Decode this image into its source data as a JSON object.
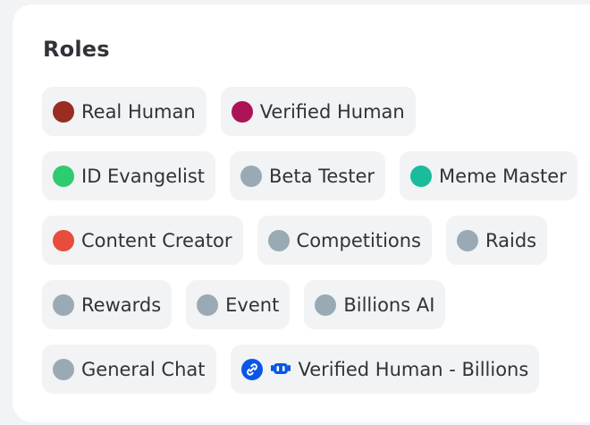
{
  "section": {
    "title": "Roles"
  },
  "colors": {
    "dark_red": "#992d22",
    "crimson": "#ad1457",
    "green": "#2ecc71",
    "gray": "#99aab5",
    "teal": "#1abc9c",
    "red": "#e74c3c",
    "blue": "#0a57e6"
  },
  "roles": [
    {
      "label": "Real Human",
      "color": "#992d22"
    },
    {
      "label": "Verified Human",
      "color": "#ad1457"
    },
    {
      "label": "ID Evangelist",
      "color": "#2ecc71"
    },
    {
      "label": "Beta Tester",
      "color": "#99aab5"
    },
    {
      "label": "Meme Master",
      "color": "#1abc9c"
    },
    {
      "label": "Content Creator",
      "color": "#e74c3c"
    },
    {
      "label": "Competitions",
      "color": "#99aab5"
    },
    {
      "label": "Raids",
      "color": "#99aab5"
    },
    {
      "label": "Rewards",
      "color": "#99aab5"
    },
    {
      "label": "Event",
      "color": "#99aab5"
    },
    {
      "label": "Billions AI",
      "color": "#99aab5"
    },
    {
      "label": "General Chat",
      "color": "#99aab5"
    },
    {
      "label": "Verified Human - Billions",
      "icons": [
        "link-badge-icon",
        "robot-badge-icon"
      ]
    }
  ]
}
